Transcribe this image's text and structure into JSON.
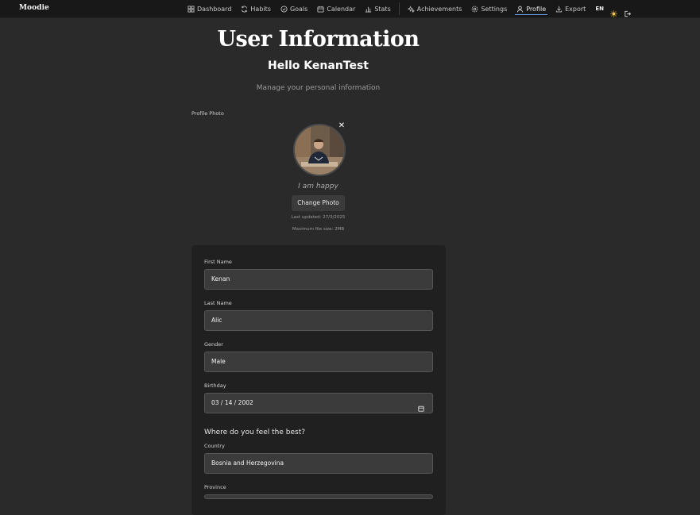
{
  "brand": "Moodie",
  "nav": {
    "items": [
      {
        "label": "Dashboard",
        "icon": "dashboard-icon"
      },
      {
        "label": "Habits",
        "icon": "habits-icon"
      },
      {
        "label": "Goals",
        "icon": "goals-icon"
      },
      {
        "label": "Calendar",
        "icon": "calendar-icon"
      },
      {
        "label": "Stats",
        "icon": "stats-icon"
      },
      {
        "label": "Achievements",
        "icon": "achievements-icon"
      },
      {
        "label": "Settings",
        "icon": "settings-icon"
      },
      {
        "label": "Profile",
        "icon": "profile-icon",
        "active": true
      },
      {
        "label": "Export",
        "icon": "export-icon"
      }
    ],
    "language": "EN",
    "theme_icon": "sun-icon",
    "logout_icon": "logout-icon",
    "active_color": "#6ea8ff"
  },
  "header": {
    "title": "User Information",
    "greeting": "Hello KenanTest",
    "subtitle": "Manage your personal information"
  },
  "photo": {
    "label": "Profile Photo",
    "mood_text": "I am happy",
    "change_button": "Change Photo",
    "last_updated": "Last updated: 27/3/2025",
    "max_size": "Maximum file size: 2MB",
    "remove_icon": "close-icon"
  },
  "form": {
    "first_name": {
      "label": "First Name",
      "value": "Kenan"
    },
    "last_name": {
      "label": "Last Name",
      "value": "Alic"
    },
    "gender": {
      "label": "Gender",
      "value": "Male"
    },
    "birthday": {
      "label": "Birthday",
      "value": "03 / 14 / 2002",
      "icon": "calendar-picker-icon"
    },
    "location_heading": "Where do you feel the best?",
    "country": {
      "label": "Country",
      "value": "Bosnia and Herzegovina"
    },
    "province": {
      "label": "Province",
      "value": ""
    }
  },
  "colors": {
    "background": "#2a2a2a",
    "nav_background": "#181818",
    "card_background": "#202020",
    "input_background": "#3b3b3b"
  }
}
